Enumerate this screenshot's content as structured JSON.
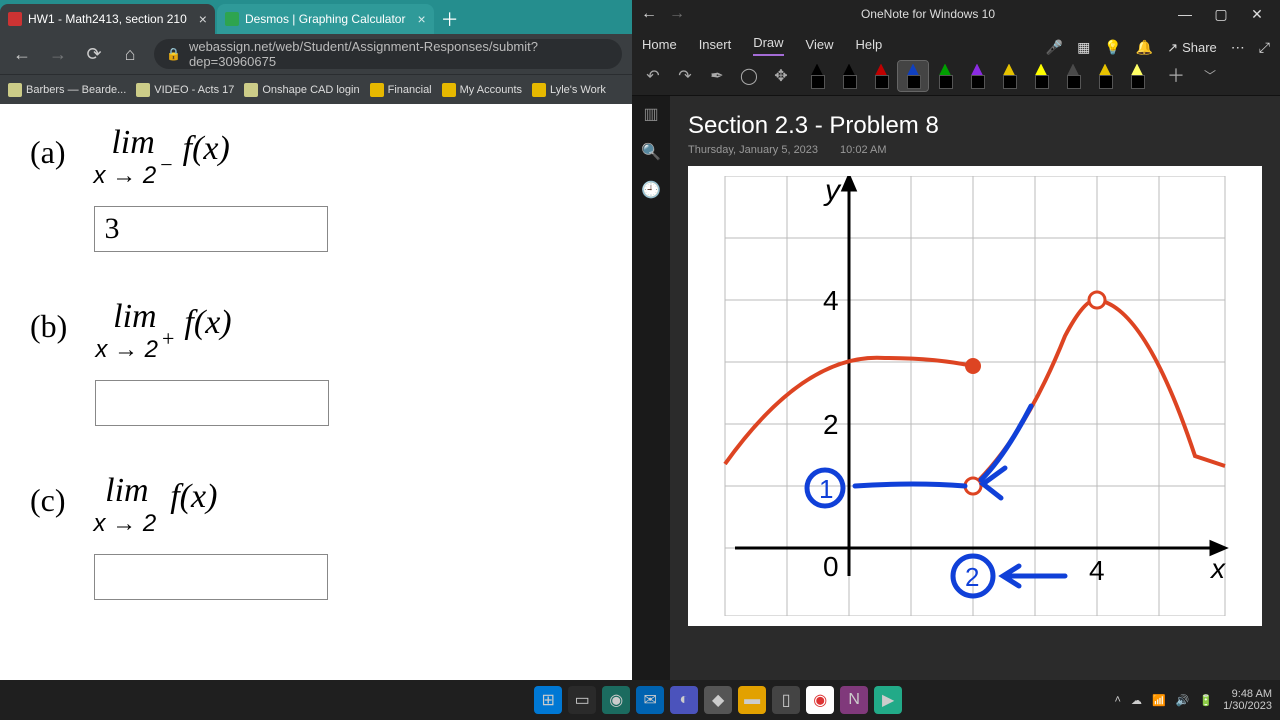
{
  "chrome": {
    "tabs": [
      {
        "title": "HW1 - Math2413, section 210",
        "active": true
      },
      {
        "title": "Desmos | Graphing Calculator",
        "active": false
      }
    ],
    "url": "webassign.net/web/Student/Assignment-Responses/submit?dep=30960675",
    "bookmarks": [
      "Barbers — Bearde...",
      "VIDEO - Acts 17",
      "Onshape CAD login",
      "Financial",
      "My Accounts",
      "Lyle's Work"
    ],
    "questions": {
      "a": {
        "label": "(a)",
        "approach": "x → 2",
        "sup": "−",
        "func": "f(x)",
        "answer": "3"
      },
      "b": {
        "label": "(b)",
        "approach": "x → 2",
        "sup": "+",
        "func": "f(x)",
        "answer": ""
      },
      "c": {
        "label": "(c)",
        "approach": "x → 2",
        "sup": "",
        "func": "f(x)",
        "answer": ""
      }
    },
    "lim_word": "lim"
  },
  "onenote": {
    "app_name": "OneNote for Windows 10",
    "ribbon_tabs": [
      "Home",
      "Insert",
      "Draw",
      "View",
      "Help"
    ],
    "active_tab": "Draw",
    "share_label": "Share",
    "page_title": "Section 2.3 - Problem 8",
    "page_date": "Thursday, January 5, 2023",
    "page_time": "10:02 AM",
    "pen_colors": [
      "#000000",
      "#000000",
      "#c00000",
      "#1040c0",
      "#00a000",
      "#8a2be2",
      "#e6c200"
    ],
    "hl_colors": [
      "#ffff00",
      "#4a4a4a",
      "#e6c200",
      "#ffff66"
    ],
    "graph": {
      "y_label": "y",
      "x_label": "x",
      "y_ticks": [
        "4",
        "2",
        "0"
      ],
      "x_ticks": [
        "4"
      ],
      "notes": {
        "circle1": "1",
        "circle2": "2"
      }
    }
  },
  "taskbar": {
    "time": "9:48 AM",
    "date": "1/30/2023"
  },
  "chart_data": {
    "type": "line",
    "title": "Graph of f(x) (Section 2.3 Problem 8)",
    "xlabel": "x",
    "ylabel": "y",
    "xlim": [
      -2,
      6
    ],
    "ylim": [
      0,
      5
    ],
    "x_ticks": [
      0,
      2,
      4
    ],
    "y_ticks": [
      0,
      2,
      4
    ],
    "series": [
      {
        "name": "red-curve-left",
        "x": [
          -2,
          -1,
          0,
          1,
          2
        ],
        "y": [
          1.4,
          2.6,
          3.0,
          3.1,
          3.0
        ]
      },
      {
        "name": "red-curve-right",
        "x": [
          2,
          2.5,
          3,
          3.5,
          4,
          5,
          6
        ],
        "y": [
          1.0,
          1.4,
          2.4,
          3.6,
          4.0,
          3.0,
          1.4
        ]
      }
    ],
    "points": [
      {
        "x": 2,
        "y": 3,
        "kind": "closed"
      },
      {
        "x": 2,
        "y": 1,
        "kind": "open"
      },
      {
        "x": 4,
        "y": 4,
        "kind": "open"
      }
    ],
    "annotations": [
      {
        "text": "1",
        "at": [
          -0.3,
          1.0
        ],
        "style": "blue-circle"
      },
      {
        "text": "2",
        "at": [
          2.0,
          -0.2
        ],
        "style": "blue-circle"
      },
      {
        "text": "arrow",
        "from": [
          2.9,
          1.0
        ],
        "to": [
          2.1,
          1.05
        ],
        "style": "blue-arrow-to-open-point"
      },
      {
        "text": "arrow",
        "from": [
          3.2,
          -0.2
        ],
        "to": [
          2.35,
          -0.2
        ],
        "style": "blue-arrow"
      },
      {
        "text": "blue-trace",
        "from": [
          0,
          1
        ],
        "to": [
          2,
          1
        ],
        "style": "blue-segment"
      }
    ]
  }
}
